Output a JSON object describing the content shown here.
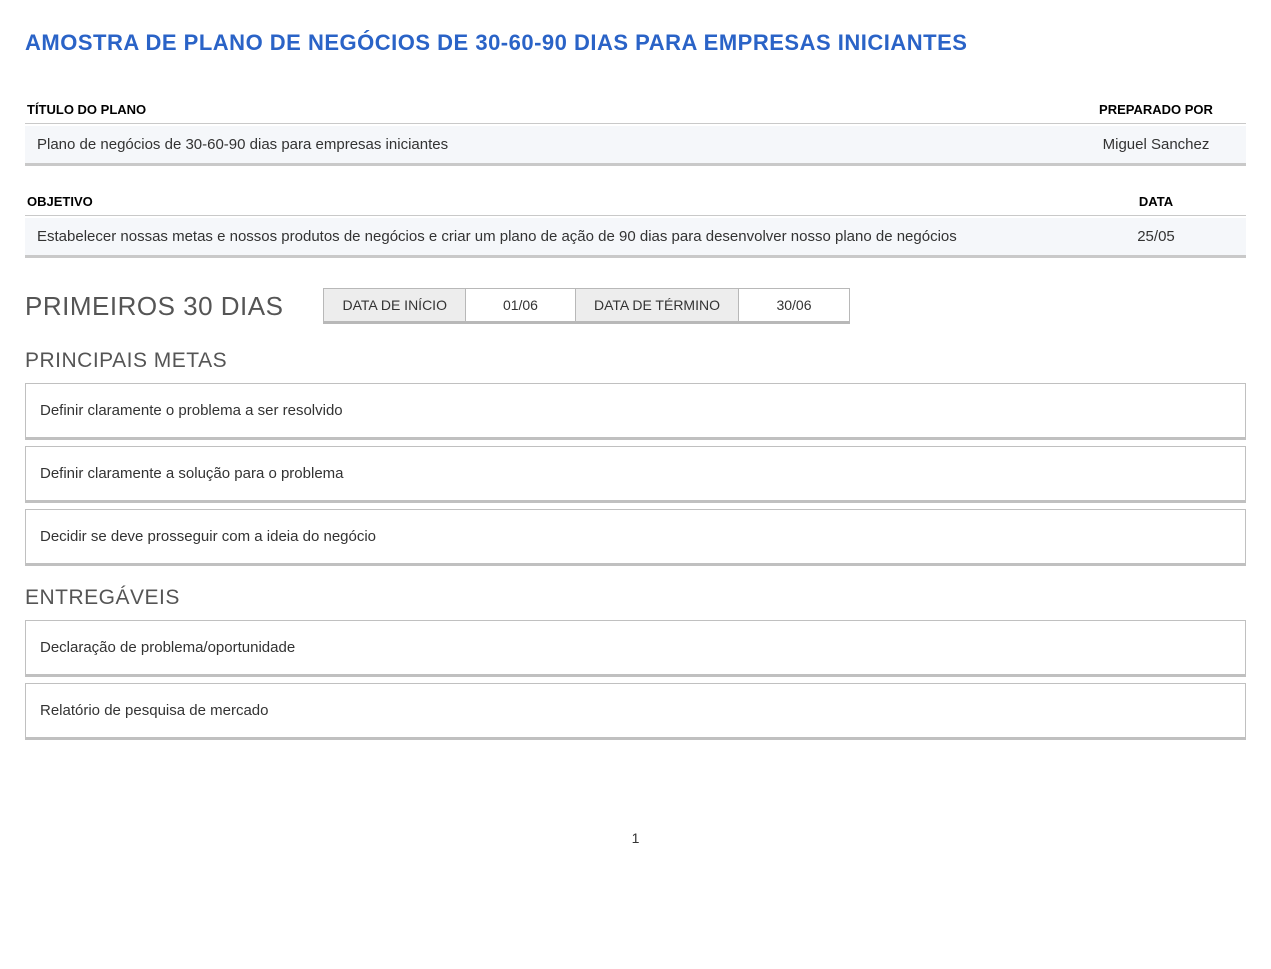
{
  "document": {
    "title": "AMOSTRA DE PLANO DE NEGÓCIOS DE 30-60-90 DIAS PARA EMPRESAS INICIANTES",
    "pageNumber": "1"
  },
  "planInfo": {
    "titleLabel": "TÍTULO DO PLANO",
    "titleValue": "Plano de negócios de 30-60-90 dias para empresas iniciantes",
    "preparedByLabel": "PREPARADO POR",
    "preparedByValue": "Miguel Sanchez",
    "objectiveLabel": "OBJETIVO",
    "objectiveValue": "Estabelecer nossas metas e nossos produtos de negócios e criar um plano de ação de 90 dias para desenvolver nosso plano de negócios",
    "dateLabel": "DATA",
    "dateValue": "25/05"
  },
  "period": {
    "title": "PRIMEIROS 30 DIAS",
    "startLabel": "DATA DE INÍCIO",
    "startValue": "01/06",
    "endLabel": "DATA DE TÉRMINO",
    "endValue": "30/06"
  },
  "goals": {
    "title": "PRINCIPAIS METAS",
    "items": [
      "Definir claramente o problema a ser resolvido",
      "Definir claramente a solução para o problema",
      "Decidir se deve prosseguir com a ideia do negócio"
    ]
  },
  "deliverables": {
    "title": "ENTREGÁVEIS",
    "items": [
      "Declaração de problema/oportunidade",
      "Relatório de pesquisa de mercado"
    ]
  }
}
